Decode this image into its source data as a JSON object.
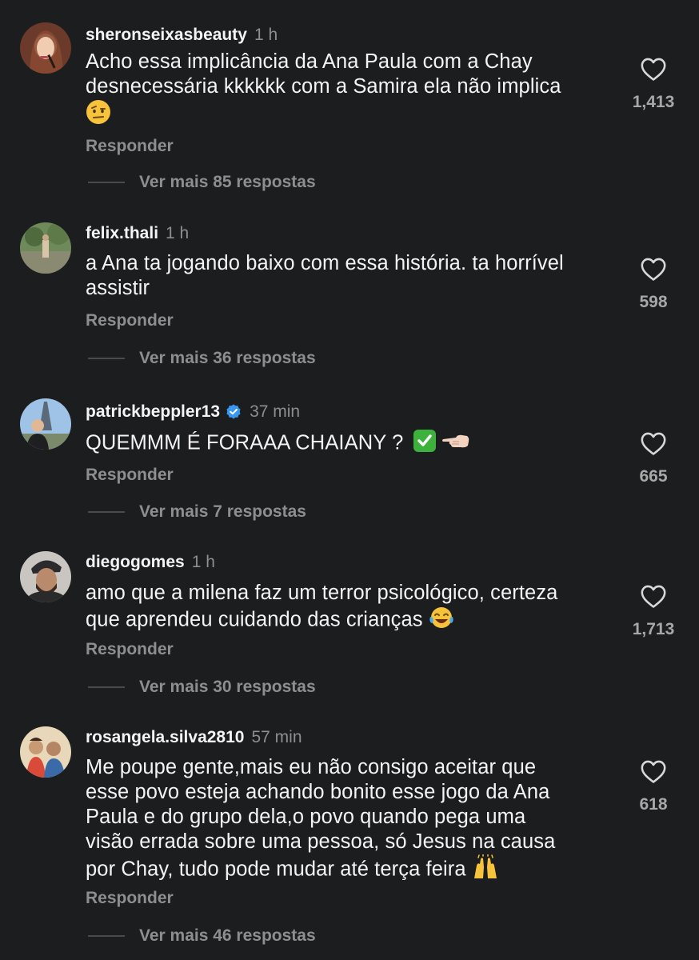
{
  "comments": [
    {
      "username": "sheronseixasbeauty",
      "time": "1 h",
      "lines": [
        "Acho essa implicância da Ana Paula com a Chay",
        "desnecessária kkkkkk com a Samira ela não implica",
        ""
      ],
      "emoji": "face-with-raised-eyebrow",
      "reply_label": "Responder",
      "more_label": "Ver mais 85 respostas",
      "likes": "1,413"
    },
    {
      "username": "felix.thali",
      "time": "1 h",
      "lines": [
        "a Ana ta jogando baixo com essa história.  ta horrível",
        "assistir"
      ],
      "reply_label": "Responder",
      "more_label": "Ver mais 36 respostas",
      "likes": "598"
    },
    {
      "username": "patrickbeppler13",
      "time": "37 min",
      "verified": true,
      "lines": [
        "QUEMMM É FORAAA CHAIANY ? "
      ],
      "emoji": "check-mark-button + backhand-index-pointing-left",
      "reply_label": "Responder",
      "more_label": "Ver mais 7 respostas",
      "likes": "665"
    },
    {
      "username": "diegogomes",
      "time": "1 h",
      "lines": [
        "amo que a milena faz um terror psicológico, certeza",
        "que aprendeu cuidando das crianças "
      ],
      "emoji": "face-with-tears-of-joy",
      "reply_label": "Responder",
      "more_label": "Ver mais 30 respostas",
      "likes": "1,713"
    },
    {
      "username": "rosangela.silva2810",
      "time": "57 min",
      "lines": [
        "Me poupe gente,mais eu não consigo aceitar que",
        "esse povo esteja achando bonito esse jogo da Ana",
        "Paula e do grupo dela,o povo quando pega uma",
        "visão errada sobre uma pessoa, só Jesus na causa",
        "por Chay, tudo pode mudar até terça feira "
      ],
      "emoji": "raising-hands",
      "reply_label": "Responder",
      "more_label": "Ver mais 46 respostas",
      "likes": "618"
    }
  ],
  "colors": {
    "background": "#1c1d1f",
    "text": "#f4f4f4",
    "muted": "#8e8e8e",
    "verified": "#3897f0"
  },
  "icons": {
    "like": "heart-outline-icon",
    "verified": "verified-badge-icon"
  }
}
